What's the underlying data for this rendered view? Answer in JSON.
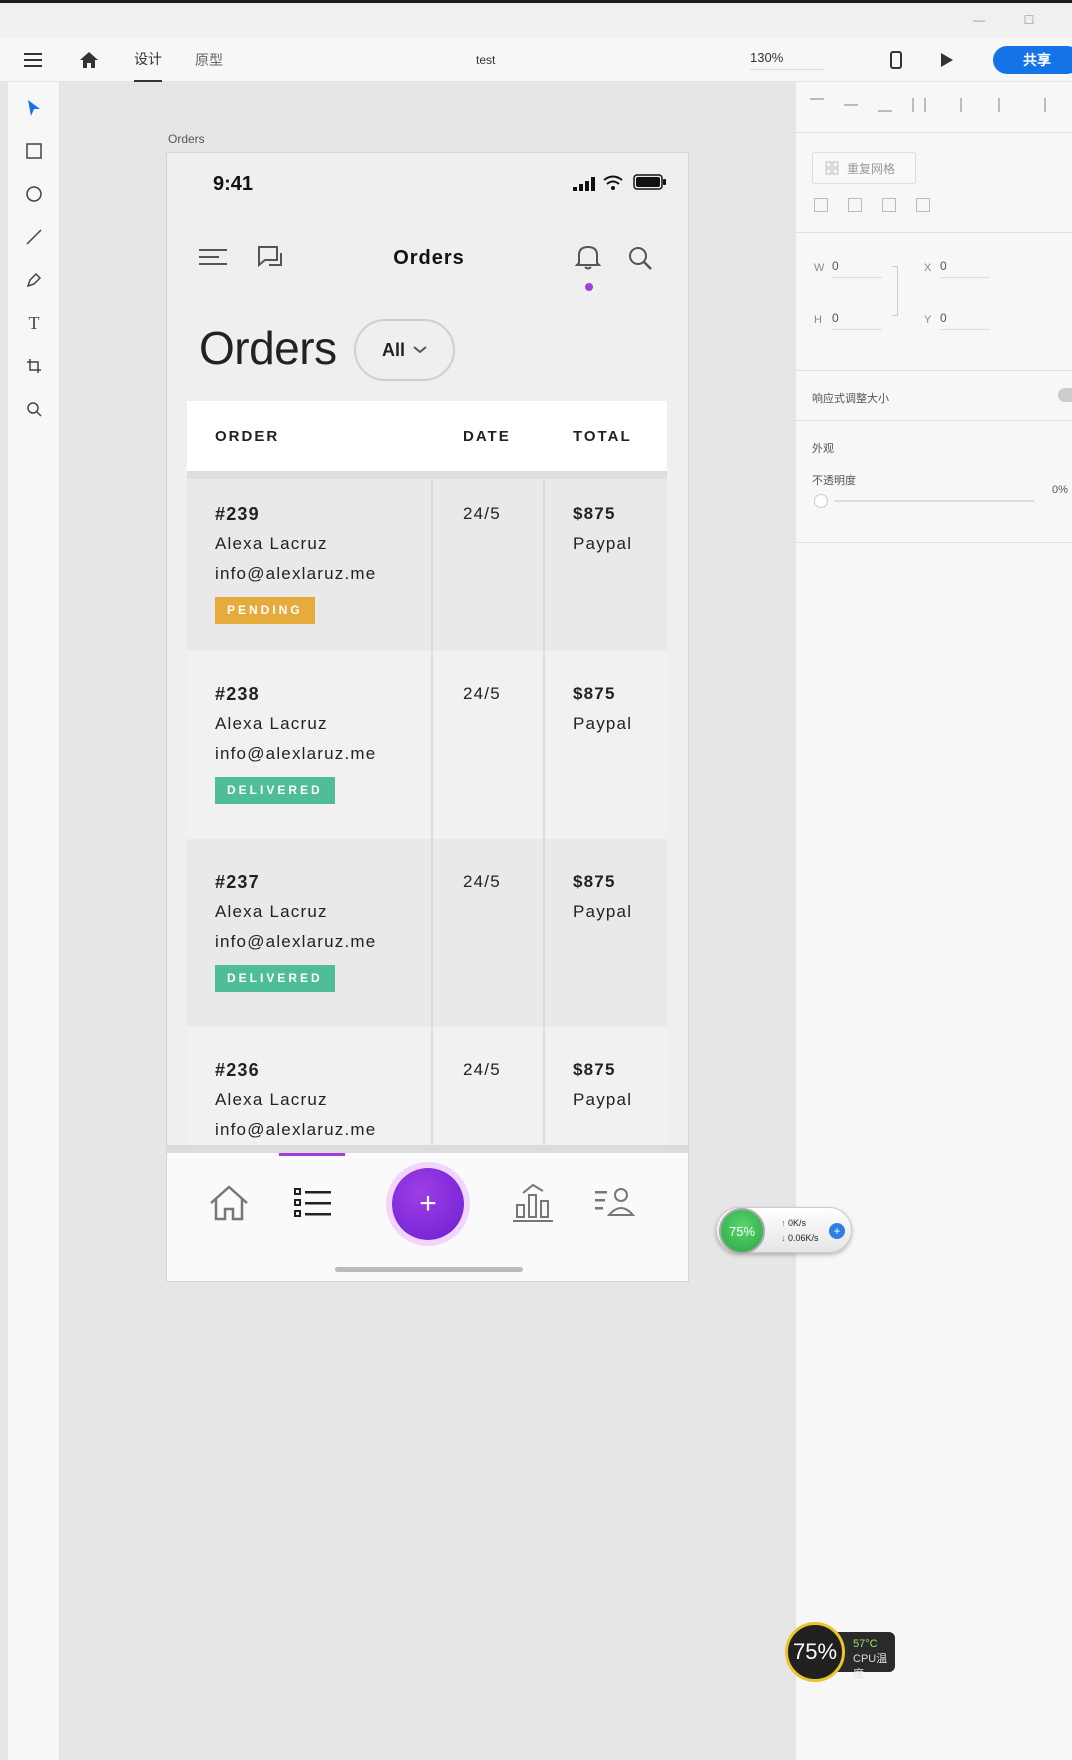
{
  "toolbar": {
    "tab_design": "设计",
    "tab_prototype": "原型",
    "document_title": "test",
    "zoom": "130%",
    "share": "共享"
  },
  "right_panel": {
    "repeat_grid": "重复网格",
    "w_label": "W",
    "w_value": "0",
    "h_label": "H",
    "h_value": "0",
    "x_label": "X",
    "x_value": "0",
    "y_label": "Y",
    "y_value": "0",
    "responsive_resize": "响应式调整大小",
    "appearance": "外观",
    "opacity_label": "不透明度",
    "opacity_value": "0%"
  },
  "canvas": {
    "artboard_label": "Orders"
  },
  "app": {
    "status_time": "9:41",
    "header_title": "Orders",
    "page_title": "Orders",
    "filter_value": "All",
    "columns": [
      "ORDER",
      "DATE",
      "TOTAL"
    ],
    "rows": [
      {
        "id": "#239",
        "name": "Alexa Lacruz",
        "email": "info@alexlaruz.me",
        "status": "PENDING",
        "date": "24/5",
        "total": "$875",
        "method": "Paypal"
      },
      {
        "id": "#238",
        "name": "Alexa Lacruz",
        "email": "info@alexlaruz.me",
        "status": "DELIVERED",
        "date": "24/5",
        "total": "$875",
        "method": "Paypal"
      },
      {
        "id": "#237",
        "name": "Alexa Lacruz",
        "email": "info@alexlaruz.me",
        "status": "DELIVERED",
        "date": "24/5",
        "total": "$875",
        "method": "Paypal"
      },
      {
        "id": "#236",
        "name": "Alexa Lacruz",
        "email": "info@alexlaruz.me",
        "status": "",
        "date": "24/5",
        "total": "$875",
        "method": "Paypal"
      }
    ],
    "colors": {
      "accent": "#a23de0",
      "pending": "#e5ac3d",
      "delivered": "#4fbd98",
      "share": "#1473e6"
    }
  },
  "widgets": {
    "net_percent": "75%",
    "net_up": "0K/s",
    "net_down": "0.06K/s",
    "cpu_percent": "75%",
    "cpu_temp": "57°C",
    "cpu_label": "CPU温度"
  }
}
